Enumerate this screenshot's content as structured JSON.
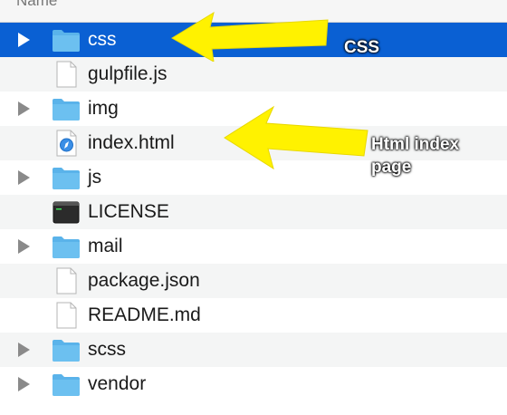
{
  "header": {
    "column_label": "Name"
  },
  "files": [
    {
      "name": "css",
      "kind": "folder",
      "expandable": true,
      "selected": true,
      "icon": "folder-icon"
    },
    {
      "name": "gulpfile.js",
      "kind": "file",
      "expandable": false,
      "selected": false,
      "icon": "document-icon"
    },
    {
      "name": "img",
      "kind": "folder",
      "expandable": true,
      "selected": false,
      "icon": "folder-icon"
    },
    {
      "name": "index.html",
      "kind": "html",
      "expandable": false,
      "selected": false,
      "icon": "safari-html-icon"
    },
    {
      "name": "js",
      "kind": "folder",
      "expandable": true,
      "selected": false,
      "icon": "folder-icon"
    },
    {
      "name": "LICENSE",
      "kind": "terminal",
      "expandable": false,
      "selected": false,
      "icon": "terminal-icon"
    },
    {
      "name": "mail",
      "kind": "folder",
      "expandable": true,
      "selected": false,
      "icon": "folder-icon"
    },
    {
      "name": "package.json",
      "kind": "file",
      "expandable": false,
      "selected": false,
      "icon": "document-icon"
    },
    {
      "name": "README.md",
      "kind": "file",
      "expandable": false,
      "selected": false,
      "icon": "document-icon"
    },
    {
      "name": "scss",
      "kind": "folder",
      "expandable": true,
      "selected": false,
      "icon": "folder-icon"
    },
    {
      "name": "vendor",
      "kind": "folder",
      "expandable": true,
      "selected": false,
      "icon": "folder-icon"
    }
  ],
  "annotations": {
    "css_label": "CSS",
    "html_label_line1": "Html index",
    "html_label_line2": "page",
    "arrow_color": "#fff200"
  },
  "colors": {
    "selection": "#0a60d3",
    "folder": "#6cc0f0",
    "alt_row": "#f4f5f5"
  }
}
